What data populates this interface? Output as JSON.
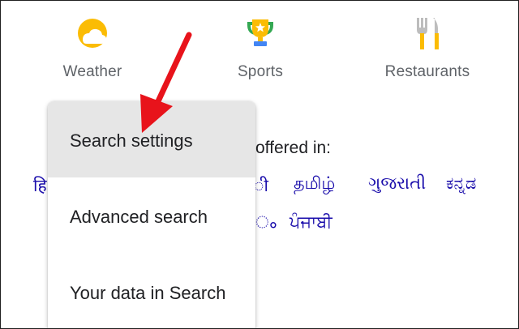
{
  "shortcuts": [
    {
      "label": "Weather",
      "icon": "weather-icon"
    },
    {
      "label": "Sports",
      "icon": "trophy-icon"
    },
    {
      "label": "Restaurants",
      "icon": "fork-knife-icon"
    }
  ],
  "languages": {
    "offered_text": "offered in:",
    "row1": [
      "हि",
      "ी",
      "தமிழ்",
      "ગુજરાતી",
      "ಕನ್ನಡ"
    ],
    "row2": [
      "ം",
      "ਪੰਜਾਬੀ"
    ]
  },
  "menu": {
    "items": [
      {
        "label": "Search settings"
      },
      {
        "label": "Advanced search"
      },
      {
        "label": "Your data in Search"
      }
    ]
  },
  "colors": {
    "highlight": "#e6e6e6",
    "arrow": "#e8131b",
    "link": "#1a0dab",
    "muted_label": "#5f6368"
  }
}
